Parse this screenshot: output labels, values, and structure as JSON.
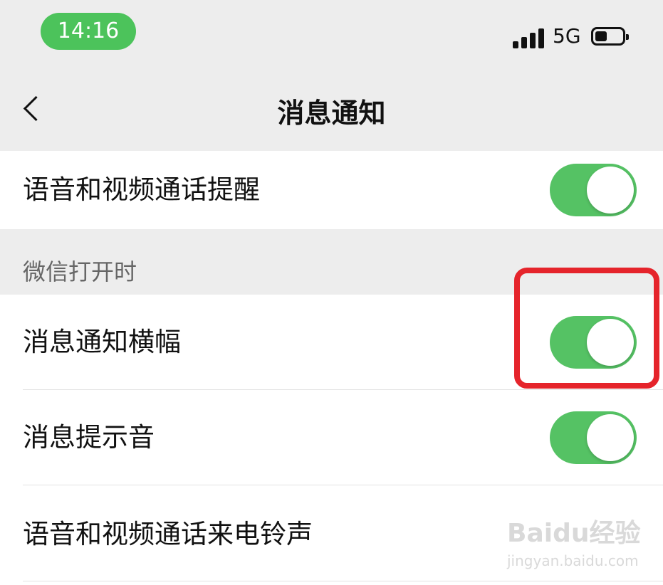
{
  "status_bar": {
    "time": "14:16",
    "network": "5G"
  },
  "nav": {
    "title": "消息通知"
  },
  "rows": {
    "call_reminder": {
      "label": "语音和视频通话提醒",
      "enabled": true
    },
    "banner": {
      "label": "消息通知横幅",
      "enabled": true
    },
    "sound": {
      "label": "消息提示音",
      "enabled": true
    },
    "ringtone": {
      "label": "语音和视频通话来电铃声"
    }
  },
  "section": {
    "header": "微信打开时"
  },
  "watermark": {
    "brand": "Baidu经验",
    "url": "jingyan.baidu.com"
  },
  "colors": {
    "toggle_on": "#55c264",
    "time_pill": "#4cc35b",
    "highlight": "#e5242b",
    "background": "#ededed"
  }
}
